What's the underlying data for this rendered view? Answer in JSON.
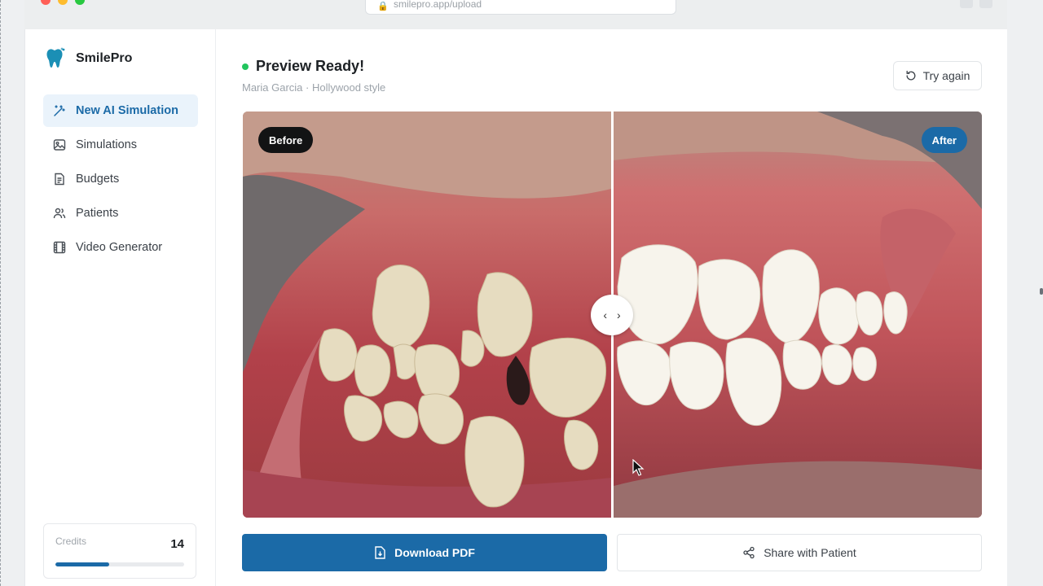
{
  "browser": {
    "url": "smilepro.app/upload",
    "traffic_colors": [
      "#ff5f57",
      "#febc2e",
      "#28c840"
    ]
  },
  "app": {
    "name": "SmilePro",
    "accent": "#1b6aa7"
  },
  "sidebar": {
    "items": [
      {
        "label": "New AI Simulation",
        "icon": "magic-wand-icon",
        "active": true
      },
      {
        "label": "Simulations",
        "icon": "image-icon"
      },
      {
        "label": "Budgets",
        "icon": "document-icon"
      },
      {
        "label": "Patients",
        "icon": "users-icon"
      },
      {
        "label": "Video Generator",
        "icon": "film-icon"
      }
    ],
    "credits": {
      "label": "Credits",
      "value": "14",
      "fill_fraction": 0.42
    }
  },
  "main": {
    "title": "Preview Ready!",
    "subtitle": "Maria Garcia · Hollywood style",
    "retry_label": "Try again",
    "status_color": "#22c55e",
    "compare": {
      "before_label": "Before",
      "after_label": "After"
    },
    "download_label": "Download PDF",
    "share_label": "Share with Patient"
  }
}
